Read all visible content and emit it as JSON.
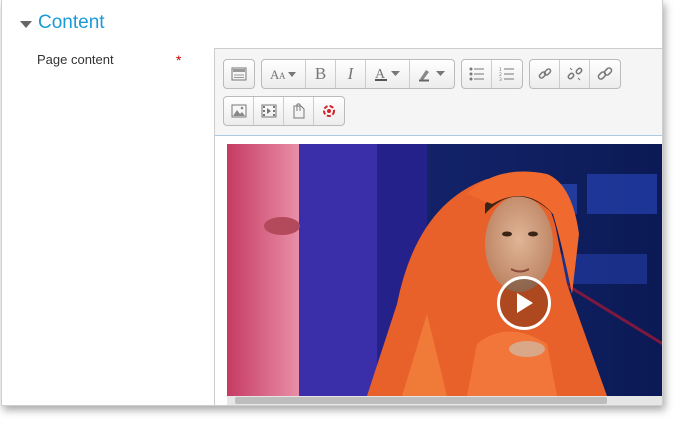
{
  "section": {
    "title": "Content"
  },
  "field": {
    "label": "Page content",
    "required_marker": "*"
  },
  "toolbar": {
    "row1": [
      [
        "collapse-icon"
      ],
      [
        "font-style-icon",
        "bold-icon",
        "italic-icon",
        "font-color-icon",
        "highlight-icon"
      ],
      [
        "bullet-list-icon",
        "numbered-list-icon"
      ],
      [
        "link-icon",
        "unlink-icon",
        "chain-icon"
      ]
    ],
    "row2": [
      "image-icon",
      "media-icon",
      "manage-files-icon",
      "recordrtc-icon"
    ],
    "bold_glyph": "B",
    "italic_glyph": "I"
  },
  "editor": {
    "embedded": "video",
    "control": "play-icon"
  }
}
